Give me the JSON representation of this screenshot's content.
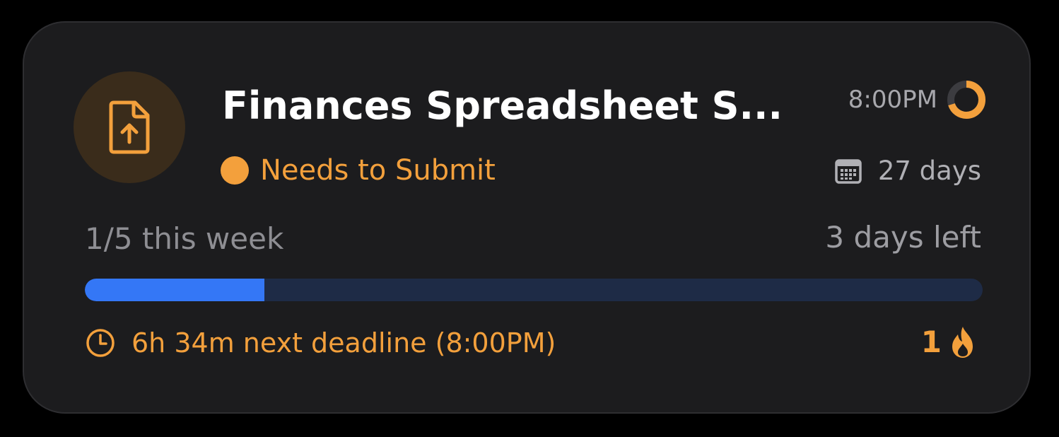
{
  "task": {
    "title": "Finances Spreadsheet S...",
    "status": "Needs to Submit",
    "due_time": "8:00PM",
    "due_ring_fraction": 0.7,
    "days": "27 days"
  },
  "progress": {
    "count_label": "1/5 this week",
    "remaining_label": "3 days left",
    "fraction": 0.2
  },
  "deadline": {
    "label": "6h 34m next deadline (8:00PM)"
  },
  "streak": {
    "count": "1"
  },
  "icons": {
    "file": "file-upload-icon",
    "ring": "progress-ring-icon",
    "calendar": "calendar-icon",
    "clock": "clock-icon",
    "flame": "flame-icon"
  },
  "colors": {
    "accent_orange": "#f3a03c",
    "progress_blue": "#3477f6",
    "progress_track": "#1e2b46",
    "card_bg": "#1c1c1e"
  }
}
